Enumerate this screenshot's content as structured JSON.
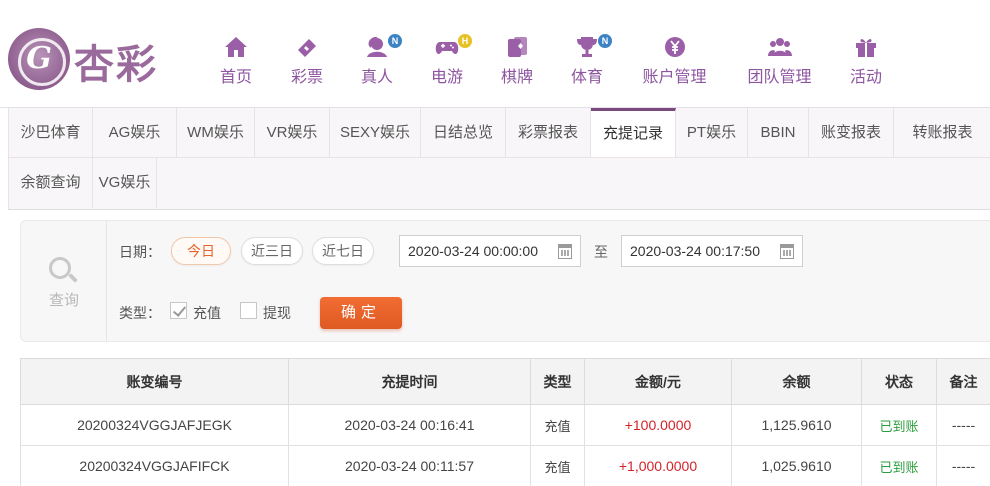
{
  "brand": {
    "emblem_letter": "G",
    "name": "杏彩"
  },
  "nav": [
    {
      "label": "首页",
      "icon": "home-icon",
      "badge": ""
    },
    {
      "label": "彩票",
      "icon": "lottery-ticket-icon",
      "badge": ""
    },
    {
      "label": "真人",
      "icon": "live-dealer-icon",
      "badge": "N"
    },
    {
      "label": "电游",
      "icon": "gamepad-icon",
      "badge": "H"
    },
    {
      "label": "棋牌",
      "icon": "cards-icon",
      "badge": ""
    },
    {
      "label": "体育",
      "icon": "trophy-icon",
      "badge": "N"
    },
    {
      "label": "账户管理",
      "icon": "yen-coin-icon",
      "badge": ""
    },
    {
      "label": "团队管理",
      "icon": "team-icon",
      "badge": ""
    },
    {
      "label": "活动",
      "icon": "gift-icon",
      "badge": ""
    }
  ],
  "tabs": {
    "row1": [
      "沙巴体育",
      "AG娱乐",
      "WM娱乐",
      "VR娱乐",
      "SEXY娱乐",
      "日结总览",
      "彩票报表",
      "充提记录",
      "PT娱乐",
      "BBIN",
      "账变报表",
      "转账报表"
    ],
    "row2": [
      "余额查询",
      "VG娱乐"
    ],
    "active": "充提记录"
  },
  "query": {
    "panel_label": "查询",
    "date_label": "日期：",
    "ranges": [
      "今日",
      "近三日",
      "近七日"
    ],
    "active_range": "今日",
    "start_datetime": "2020-03-24 00:00:00",
    "to_label": "至",
    "end_datetime": "2020-03-24 00:17:50",
    "type_label": "类型：",
    "types": [
      {
        "label": "充值",
        "checked": true
      },
      {
        "label": "提现",
        "checked": false
      }
    ],
    "confirm_label": "确定"
  },
  "table": {
    "columns": [
      "账变编号",
      "充提时间",
      "类型",
      "金额/元",
      "余额",
      "状态",
      "备注"
    ],
    "rows": [
      {
        "id": "20200324VGGJAFJEGK",
        "time": "2020-03-24 00:16:41",
        "type": "充值",
        "amount": "+100.0000",
        "balance": "1,125.9610",
        "status": "已到账",
        "note": "-----"
      },
      {
        "id": "20200324VGGJAFIFCK",
        "time": "2020-03-24 00:11:57",
        "type": "充值",
        "amount": "+1,000.0000",
        "balance": "1,025.9610",
        "status": "已到账",
        "note": "-----"
      }
    ]
  },
  "colors": {
    "brand_purple": "#8e55a0",
    "accent_orange": "#e8602a",
    "amount_red": "#d2232a",
    "status_green": "#2a9d3c"
  }
}
